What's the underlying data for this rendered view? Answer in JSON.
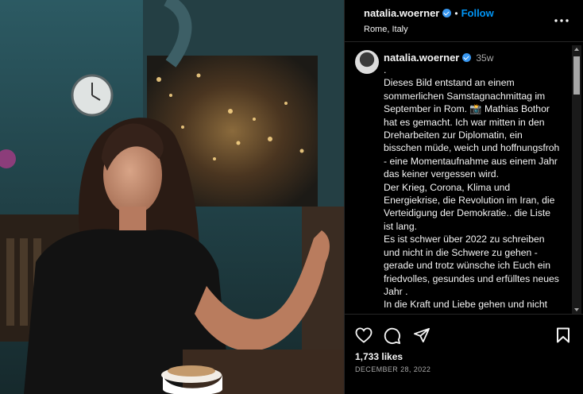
{
  "post": {
    "username": "natalia.woerner",
    "follow_label": "Follow",
    "location": "Rome, Italy",
    "separator": "•"
  },
  "caption": {
    "username": "natalia.woerner",
    "time": "35w",
    "text": ".\nDieses Bild entstand an einem sommerlichen Samstagnachmittag im September in Rom. 📸 Mathias Bothor hat es gemacht. Ich war mitten in den Dreharbeiten zur Diplomatin, ein bisschen müde, weich und hoffnungsfroh - eine Momentaufnahme aus einem Jahr das keiner vergessen wird.\nDer Krieg, Corona, Klima und Energiekrise, die Revolution im Iran, die Verteidigung der Demokratie.. die Liste ist lang.\nEs ist schwer über 2022 zu schreiben und nicht in die Schwere zu gehen - gerade und trotz wünsche ich Euch ein friedvolles, gesundes und erfülltes neues Jahr .\nIn die Kraft und Liebe gehen und nicht"
  },
  "stats": {
    "likes": "1,733 likes",
    "date": "DECEMBER 28, 2022"
  },
  "icons": {
    "verified": "verified-badge-icon",
    "more": "more-options-icon",
    "like": "heart-icon",
    "comment": "comment-icon",
    "share": "share-icon",
    "save": "bookmark-icon"
  },
  "colors": {
    "follow": "#0095f6",
    "verified": "#3897f0",
    "background": "#000000"
  }
}
